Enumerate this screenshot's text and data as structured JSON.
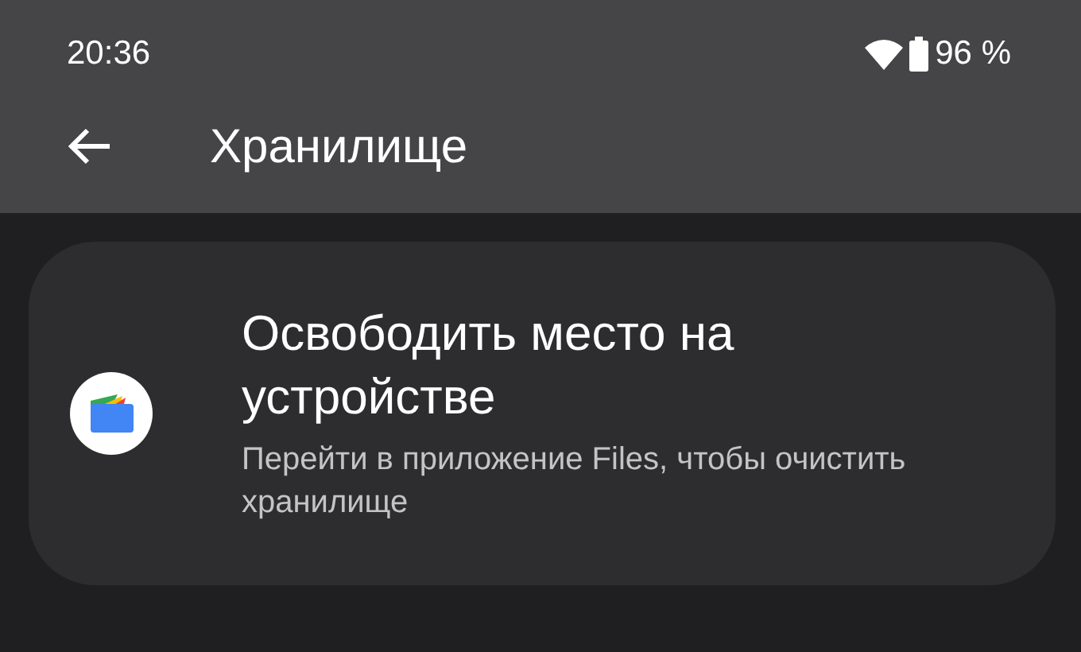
{
  "status_bar": {
    "time": "20:36",
    "battery": "96 %"
  },
  "app_bar": {
    "title": "Хранилище"
  },
  "card": {
    "title": "Освободить место на устройстве",
    "subtitle": "Перейти в приложение Files, чтобы очистить хранилище"
  }
}
